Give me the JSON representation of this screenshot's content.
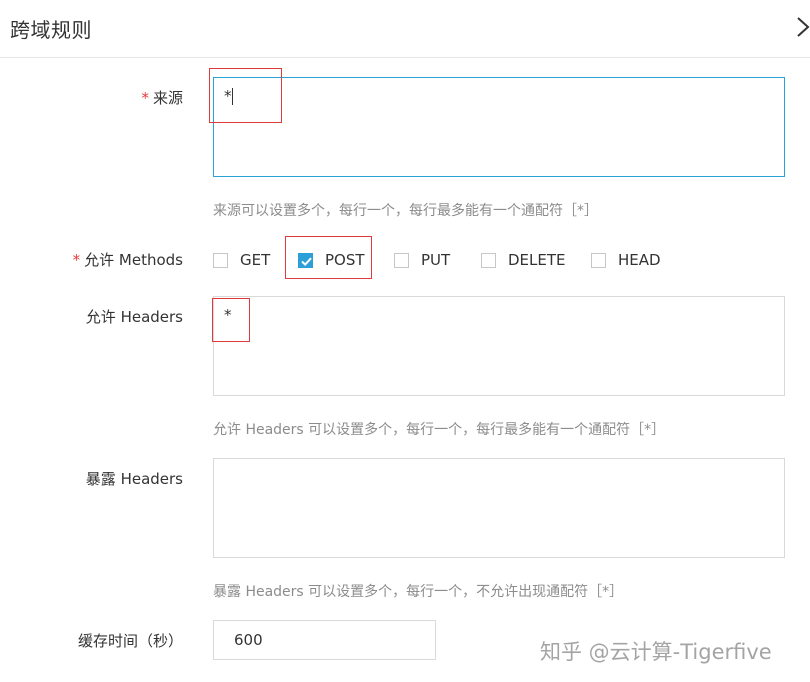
{
  "header": {
    "title": "跨域规则"
  },
  "fields": {
    "source": {
      "required_mark": "*",
      "label": "来源",
      "value": "*",
      "hint": "来源可以设置多个，每行一个，每行最多能有一个通配符［*］"
    },
    "methods": {
      "required_mark": "*",
      "label": "允许 Methods",
      "options": [
        {
          "label": "GET",
          "checked": false
        },
        {
          "label": "POST",
          "checked": true
        },
        {
          "label": "PUT",
          "checked": false
        },
        {
          "label": "DELETE",
          "checked": false
        },
        {
          "label": "HEAD",
          "checked": false
        }
      ]
    },
    "allow_headers": {
      "label": "允许 Headers",
      "value": "*",
      "hint": "允许 Headers 可以设置多个，每行一个，每行最多能有一个通配符［*］"
    },
    "expose_headers": {
      "label": "暴露 Headers",
      "value": "",
      "hint": "暴露 Headers 可以设置多个，每行一个，不允许出现通配符［*］"
    },
    "cache_time": {
      "label": "缓存时间（秒）",
      "value": "600"
    }
  },
  "watermark": {
    "text": "知乎 @云计算-Tigerfive"
  },
  "colors": {
    "accent": "#2d9fd8",
    "required": "#e4393c",
    "highlight": "#e03a3a",
    "focus_border": "#29a3d6"
  },
  "icons": {
    "close": "close-icon",
    "check": "check-icon"
  }
}
